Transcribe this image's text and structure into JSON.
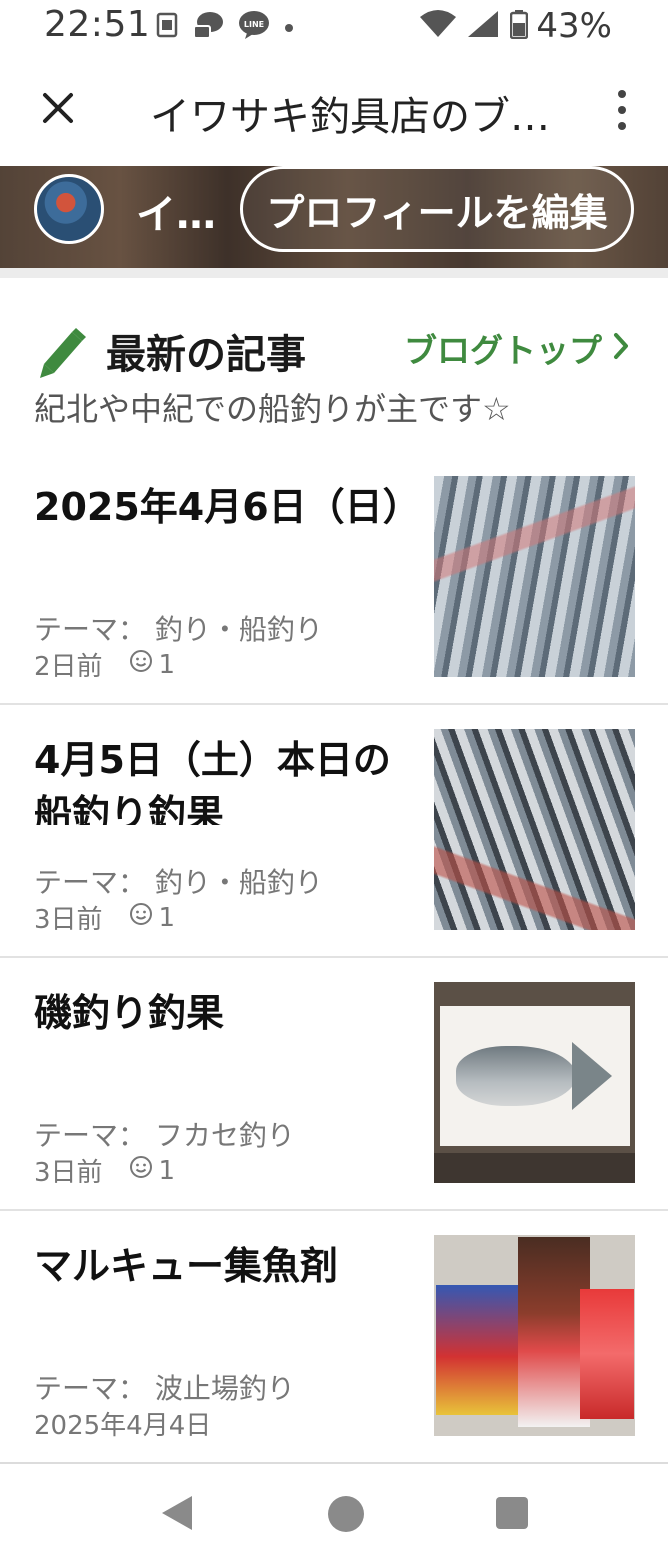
{
  "status_bar": {
    "time": "22:51",
    "battery_percent": "43%",
    "left_icons": [
      "sim-card-icon",
      "chat-bubble-icon",
      "line-app-icon",
      "dot-icon"
    ],
    "right_icons": [
      "wifi-icon",
      "signal-icon",
      "battery-icon"
    ]
  },
  "app_bar": {
    "title": "イワサキ釣具店のブ…",
    "close_icon": "close-icon",
    "menu_icon": "more-vertical-icon"
  },
  "banner": {
    "name": "イ…",
    "edit_profile_label": "プロフィールを編集"
  },
  "section": {
    "title": "最新の記事",
    "blog_top_label": "ブログトップ",
    "description": "紀北や中紀での船釣りが主です☆",
    "accent_color": "#3f8a3f"
  },
  "articles": [
    {
      "title": "2025年4月6日（日）",
      "theme": "テーマ：  釣り・船釣り",
      "date": "2日前",
      "likes": "1"
    },
    {
      "title": "4月5日（土）本日の船釣り釣果",
      "theme": "テーマ：  釣り・船釣り",
      "date": "3日前",
      "likes": "1"
    },
    {
      "title": "磯釣り釣果",
      "theme": "テーマ：  フカセ釣り",
      "date": "3日前",
      "likes": "1"
    },
    {
      "title": "マルキュー集魚剤",
      "theme": "テーマ：  波止場釣り",
      "date": "2025年4月4日",
      "likes": ""
    }
  ],
  "nav_bar": {
    "icons": [
      "back-triangle-icon",
      "home-circle-icon",
      "recents-square-icon"
    ]
  }
}
